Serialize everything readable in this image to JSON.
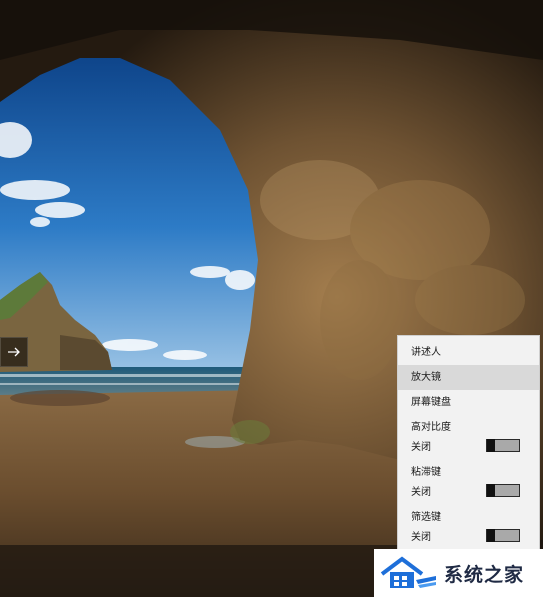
{
  "menu": {
    "items": [
      {
        "label": "讲述人"
      },
      {
        "label": "放大镜"
      },
      {
        "label": "屏幕键盘"
      }
    ],
    "toggles": [
      {
        "label": "高对比度",
        "state": "关闭"
      },
      {
        "label": "粘滞键",
        "state": "关闭"
      },
      {
        "label": "筛选键",
        "state": "关闭"
      }
    ]
  },
  "watermark": {
    "text": "系统之家"
  },
  "icons": {
    "arrow": "arrow-right-icon",
    "logo": "house-logo-icon"
  },
  "colors": {
    "menu_bg": "#f2f2f2",
    "menu_highlight": "#d9d9d9",
    "logo_blue": "#1e6fd9"
  }
}
